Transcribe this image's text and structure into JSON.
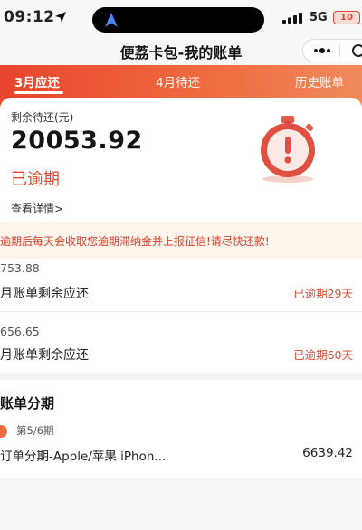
{
  "status_bar": {
    "time": "09:12",
    "network": "5G",
    "battery": "10"
  },
  "header": {
    "title": "便荔卡包-我的账单"
  },
  "tabs": [
    {
      "label": "3月应还",
      "active": true
    },
    {
      "label": "4月待还",
      "active": false
    },
    {
      "label": "历史账单",
      "active": false
    }
  ],
  "summary": {
    "remaining_label": "剩余待还(元)",
    "remaining_amount": "20053.92",
    "status": "已逾期",
    "detail_link": "查看详情>"
  },
  "notice": {
    "text": "逾期后每天会收取您逾期滞纳金并上报征信!请尽快还款!"
  },
  "bills": [
    {
      "amount": "753.88",
      "title": "月账单剩余应还",
      "status": "已逾期29天"
    },
    {
      "amount": "656.65",
      "title": "月账单剩余应还",
      "status": "已逾期60天"
    }
  ],
  "installment": {
    "heading": "账单分期",
    "period": "第5/6期",
    "item": "订单分期-Apple/苹果 iPhon...",
    "amount": "6639.42"
  },
  "colors": {
    "accent": "#e8452d",
    "accent_light": "#f08a5a",
    "overdue_text": "#e34a2f",
    "notice_bg": "#fdf4ec"
  },
  "icons": [
    "location-arrow-icon",
    "navigation-arrow-icon",
    "signal-icon",
    "battery-icon",
    "more-dots-icon",
    "close-circle-icon",
    "alarm-clock-icon"
  ]
}
